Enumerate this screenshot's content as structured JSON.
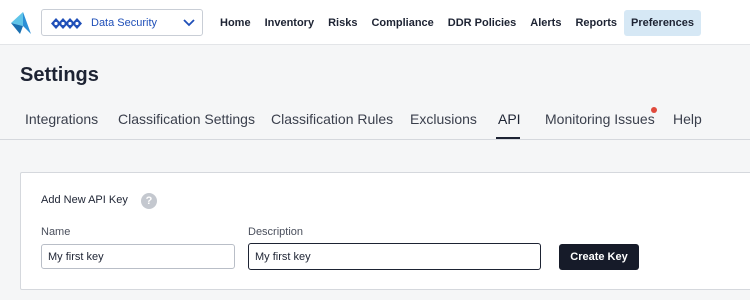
{
  "header": {
    "logo": "brand-logo-icon",
    "product_selector": {
      "selected": "Data Security",
      "icon": "data-security-icon"
    },
    "nav": [
      {
        "label": "Home",
        "active": false
      },
      {
        "label": "Inventory",
        "active": false
      },
      {
        "label": "Risks",
        "active": false
      },
      {
        "label": "Compliance",
        "active": false
      },
      {
        "label": "DDR Policies",
        "active": false
      },
      {
        "label": "Alerts",
        "active": false
      },
      {
        "label": "Reports",
        "active": false
      },
      {
        "label": "Preferences",
        "active": true
      }
    ]
  },
  "page": {
    "title": "Settings"
  },
  "tabs": [
    {
      "label": "Integrations",
      "active": false
    },
    {
      "label": "Classification Settings",
      "active": false
    },
    {
      "label": "Classification Rules",
      "active": false
    },
    {
      "label": "Exclusions",
      "active": false
    },
    {
      "label": "API",
      "active": true
    },
    {
      "label": "Monitoring Issues",
      "active": false,
      "notification": true
    },
    {
      "label": "Help",
      "active": false
    }
  ],
  "api_key_form": {
    "title": "Add New API Key",
    "help_icon": "?",
    "name_label": "Name",
    "name_value": "My first key",
    "description_label": "Description",
    "description_value": "My first key",
    "submit_label": "Create Key"
  },
  "colors": {
    "accent_blue": "#1f4fb8",
    "active_nav_bg": "#d6e8f5",
    "primary_button": "#161b29",
    "notification_dot": "#e04a3c"
  }
}
